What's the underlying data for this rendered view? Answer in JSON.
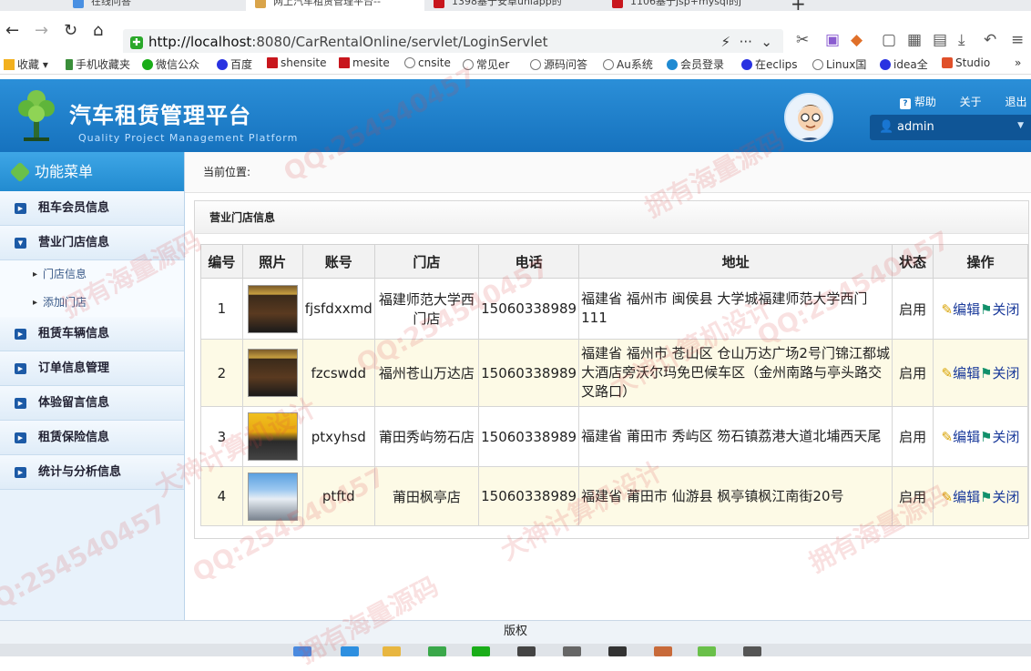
{
  "browser": {
    "tabs": [
      {
        "label": "在线问答"
      },
      {
        "label": "网上汽车租赁管理平台--"
      },
      {
        "label": "1398基于安卓uniapp的"
      },
      {
        "label": "1106基于jsp+mysql的j"
      }
    ],
    "url_host": "http://localhost",
    "url_path": ":8080/CarRentalOnline/servlet/LoginServlet",
    "bookmarks": [
      "收藏",
      "手机收藏夹",
      "微信公众",
      "百度",
      "shensite",
      "mesite",
      "cnsite",
      "常见er",
      "源码问答",
      "Au系统",
      "会员登录",
      "在eclips",
      "Linux国",
      "idea全",
      "Studio"
    ]
  },
  "header": {
    "title": "汽车租赁管理平台",
    "subtitle": "Quality Project Management Platform",
    "help_label": "帮助",
    "about_label": "关于",
    "logout_label": "退出",
    "username": "admin"
  },
  "sidebar": {
    "title": "功能菜单",
    "menu": [
      {
        "label": "租车会员信息",
        "expanded": false
      },
      {
        "label": "营业门店信息",
        "expanded": true,
        "children": [
          "门店信息",
          "添加门店"
        ]
      },
      {
        "label": "租赁车辆信息",
        "expanded": false
      },
      {
        "label": "订单信息管理",
        "expanded": false
      },
      {
        "label": "体验留言信息",
        "expanded": false
      },
      {
        "label": "租赁保险信息",
        "expanded": false
      },
      {
        "label": "统计与分析信息",
        "expanded": false
      }
    ]
  },
  "main": {
    "breadcrumb": "当前位置:",
    "panel_title": "营业门店信息",
    "table": {
      "headers": [
        "编号",
        "照片",
        "账号",
        "门店",
        "电话",
        "地址",
        "状态",
        "操作"
      ],
      "rows": [
        {
          "id": "1",
          "account": "fjsfdxxmd",
          "store": "福建师范大学西门店",
          "phone": "15060338989",
          "address": "福建省 福州市 闽侯县 大学城福建师范大学西门111",
          "status": "启用"
        },
        {
          "id": "2",
          "account": "fzcswdd",
          "store": "福州苍山万达店",
          "phone": "15060338989",
          "address": "福建省 福州市 苍山区 仓山万达广场2号门锦江都城大酒店旁沃尔玛免巴候车区（金州南路与亭头路交叉路口）",
          "status": "启用"
        },
        {
          "id": "3",
          "account": "ptxyhsd",
          "store": "莆田秀屿笏石店",
          "phone": "15060338989",
          "address": "福建省 莆田市 秀屿区 笏石镇荔港大道北埔西天尾",
          "status": "启用"
        },
        {
          "id": "4",
          "account": "ptftd",
          "store": "莆田枫亭店",
          "phone": "15060338989",
          "address": "福建省 莆田市 仙游县 枫亭镇枫江南街20号",
          "status": "启用"
        }
      ],
      "edit_label": "编辑",
      "close_label": "关闭"
    }
  },
  "footer": {
    "text": "版权"
  },
  "watermark": {
    "texts": [
      "QQ:254540457",
      "拥有海量源码",
      "大神计算机设计"
    ]
  },
  "colors": {
    "header_blue": "#1f7fcb",
    "row_alt": "#fdfae6",
    "link": "#1a3a9a"
  }
}
